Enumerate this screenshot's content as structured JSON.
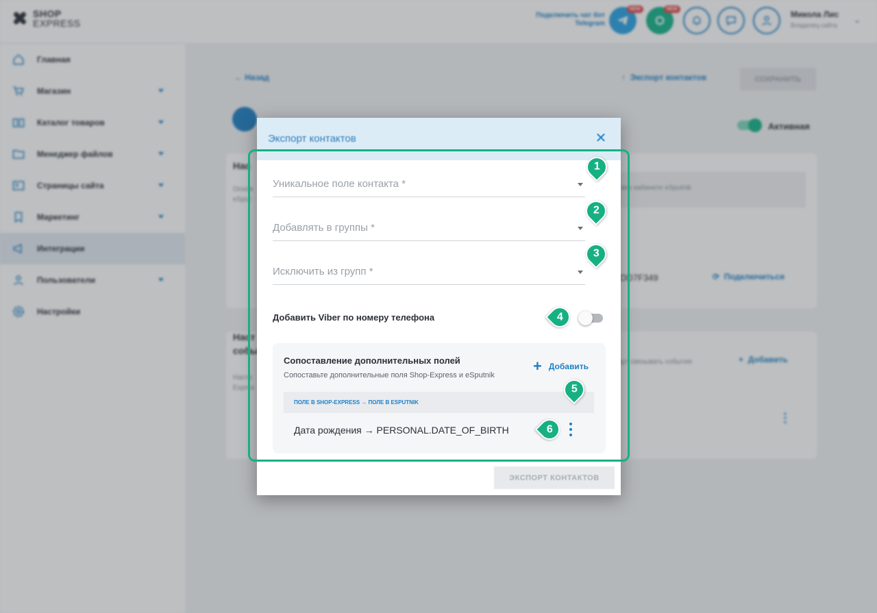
{
  "app": {
    "brand_line1": "SHOP",
    "brand_line2": "EXPRESS",
    "telegram_connect": "Подключить чат бот Telegram",
    "new_badge": "NEW",
    "user_name": "Микола Лис",
    "user_role": "Владелец сайта"
  },
  "sidebar": {
    "items": [
      {
        "label": "Главная",
        "icon": "home-icon",
        "has_arrow": false
      },
      {
        "label": "Магазин",
        "icon": "cart-icon",
        "has_arrow": true
      },
      {
        "label": "Каталог товаров",
        "icon": "book-icon",
        "has_arrow": true
      },
      {
        "label": "Менеджер файлов",
        "icon": "folder-icon",
        "has_arrow": true
      },
      {
        "label": "Страницы сайта",
        "icon": "pages-icon",
        "has_arrow": true
      },
      {
        "label": "Маркетинг",
        "icon": "marketing-icon",
        "has_arrow": true
      },
      {
        "label": "Интеграции",
        "icon": "megaphone-icon",
        "has_arrow": false,
        "active": true
      },
      {
        "label": "Пользователи",
        "icon": "users-icon",
        "has_arrow": true
      },
      {
        "label": "Настройки",
        "icon": "gear-icon",
        "has_arrow": false
      }
    ]
  },
  "main": {
    "back_label": "Назад",
    "export_label": "Экспорт контактов",
    "save_label": "СОХРАНИТЬ",
    "active_label": "Активная",
    "section1_title_fragment": "Нас",
    "section1_text": "Основ",
    "section1_text2": "eSput",
    "box_text": "вен кабинете eSputnik",
    "key_fragment": "DD7F349",
    "connect_label": "Подключиться",
    "section2_title_fragment": "Наст",
    "section2_title_fragment2": "собы",
    "section2_text": "Настр",
    "section2_text2": "Expres",
    "section2_desc": "дут связывать события",
    "add_label": "Добавить"
  },
  "dialog": {
    "title": "Экспорт контактов",
    "fields": [
      {
        "label": "Уникальное поле контакта *",
        "marker": "1"
      },
      {
        "label": "Добавлять в группы *",
        "marker": "2"
      },
      {
        "label": "Исключить из групп *",
        "marker": "3"
      }
    ],
    "viber_label": "Добавить Viber по номеру телефона",
    "viber_enabled": false,
    "viber_marker": "4",
    "mapping": {
      "title": "Сопоставление дополнительных полей",
      "subtitle": "Сопоставьте дополнительные поля Shop-Express и eSputnik",
      "add_label": "Добавить",
      "add_marker": "5",
      "column_header": "ПОЛЕ В SHOP-EXPRESS → ПОЛЕ В ESPUTNIK",
      "rows": [
        {
          "text": "Дата рождения → PERSONAL.DATE_OF_BIRTH"
        }
      ],
      "row_marker": "6"
    },
    "export_button": "ЭКСПОРТ КОНТАКТОВ"
  },
  "colors": {
    "accent": "#1d7fc4",
    "marker_green": "#16b083",
    "header_bg": "#dcecf6"
  }
}
